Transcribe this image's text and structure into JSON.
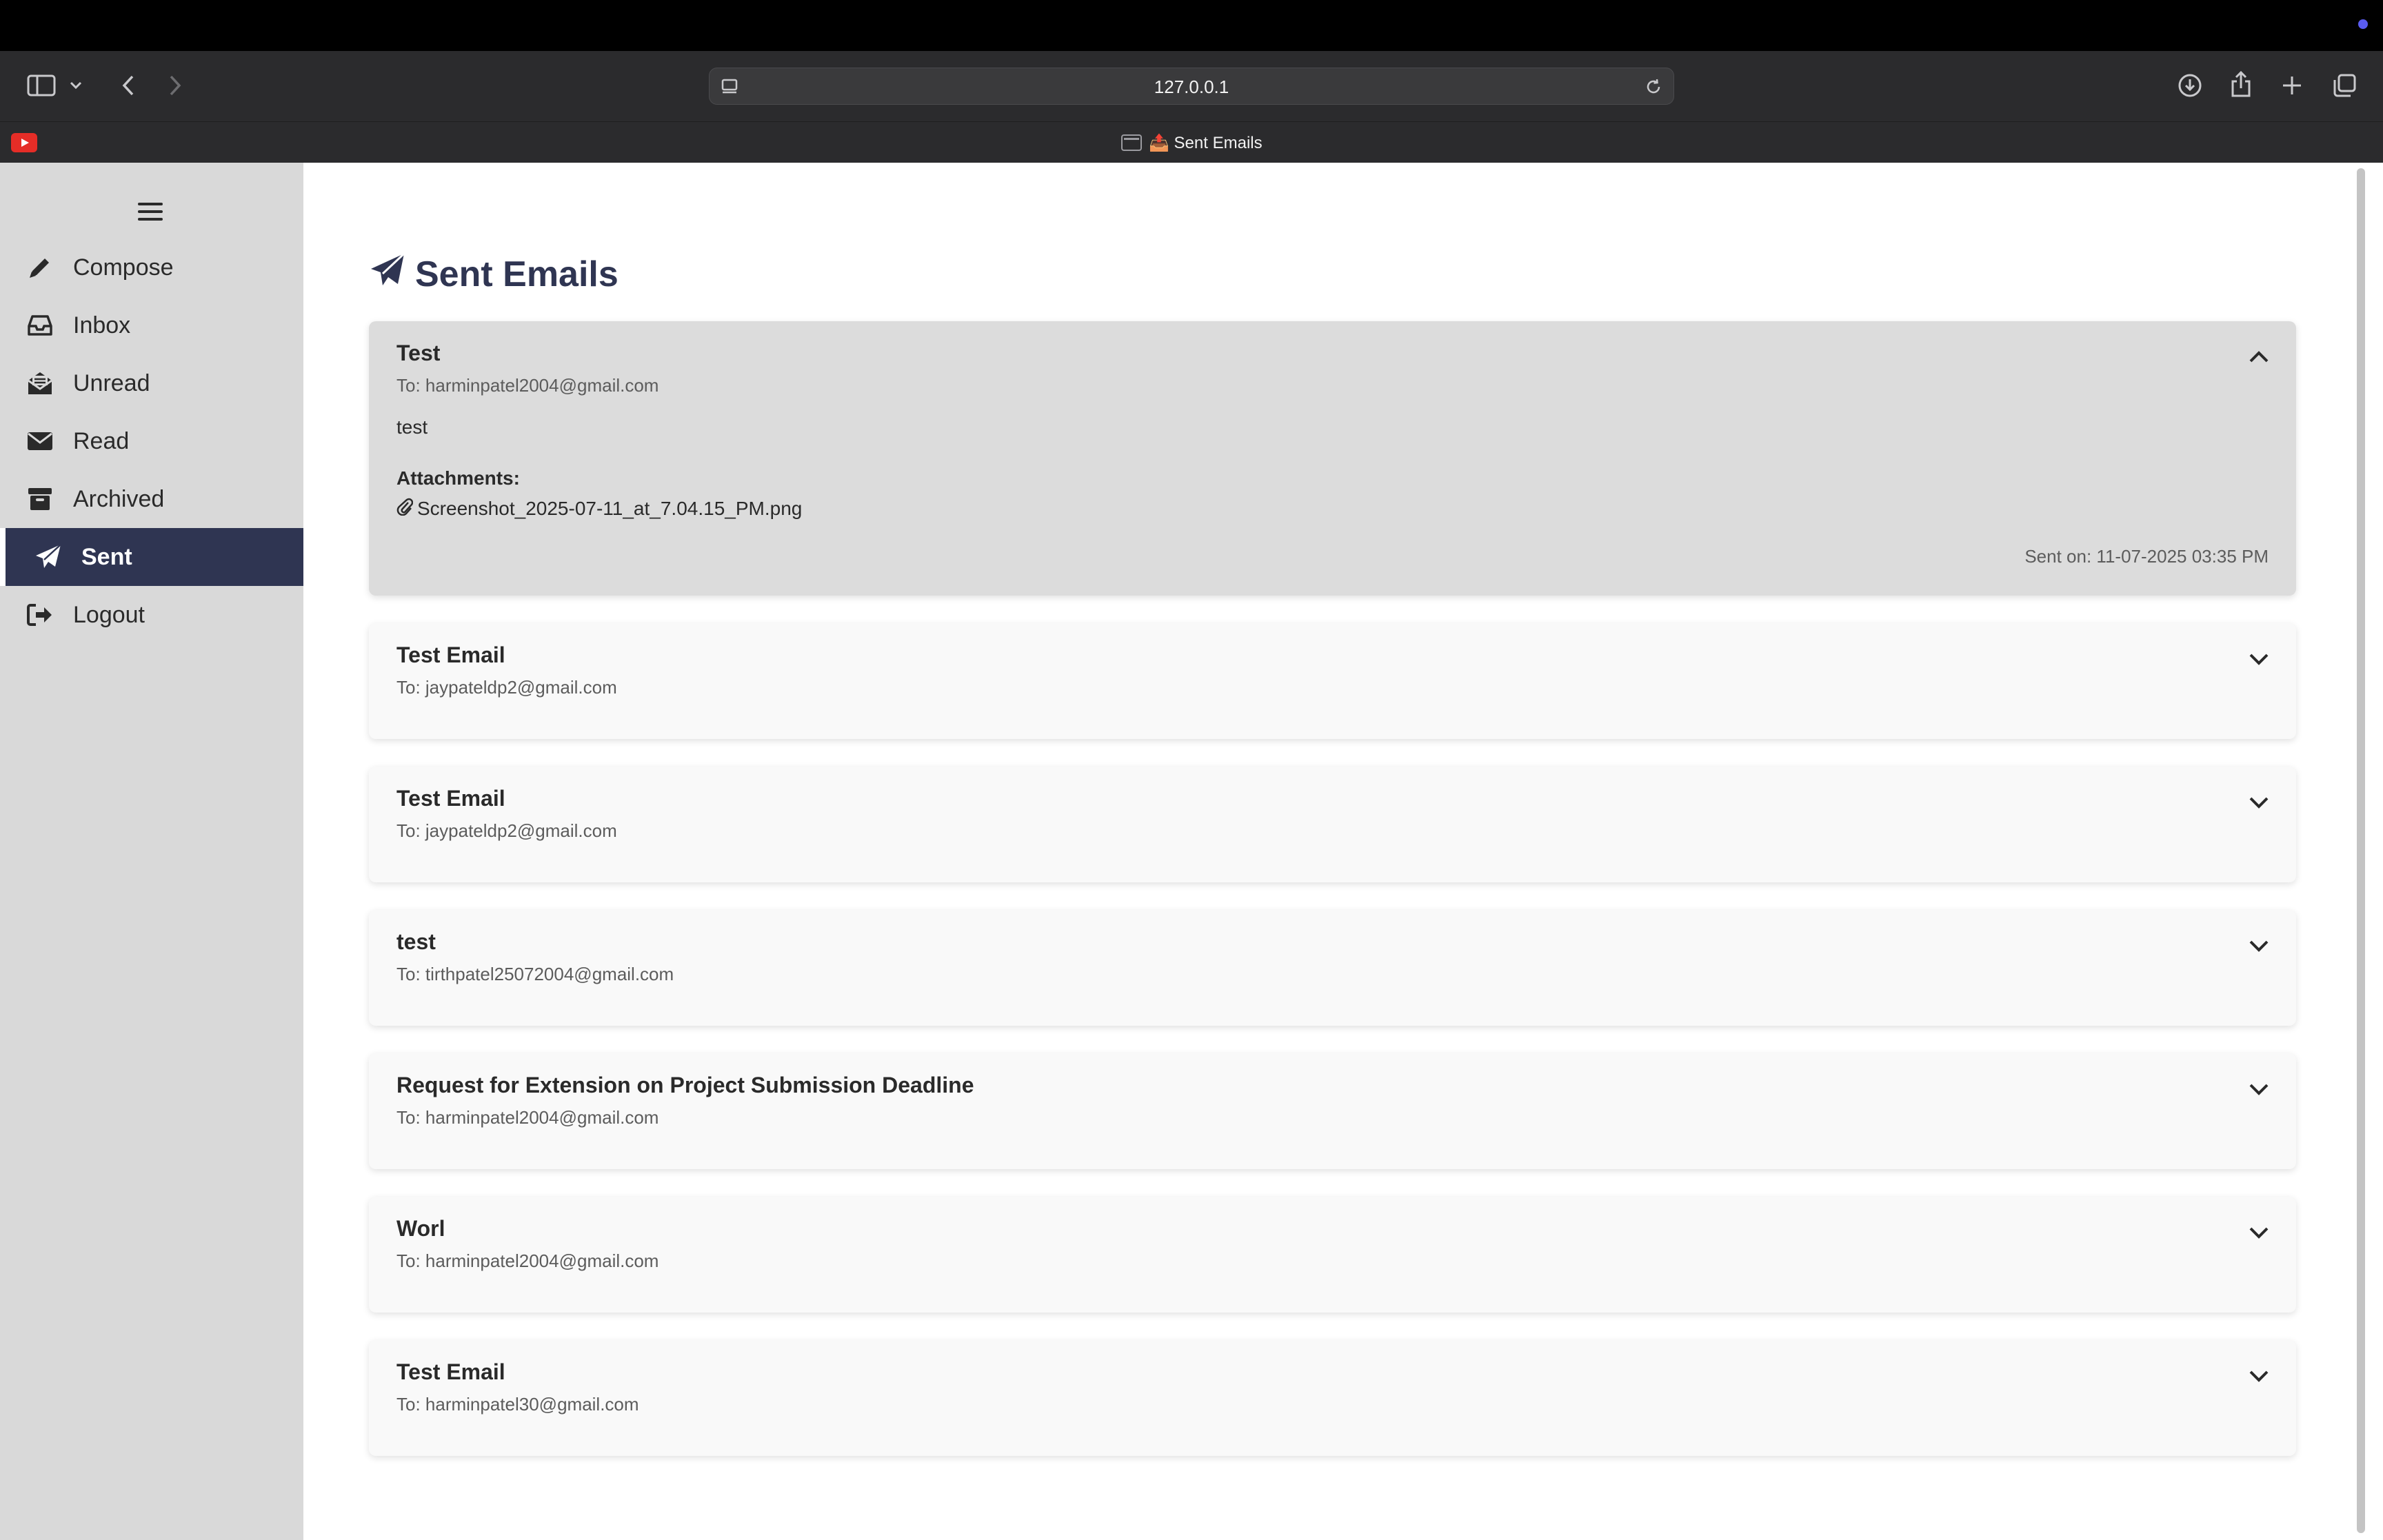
{
  "browser": {
    "url": "127.0.0.1",
    "tab_title": "📤 Sent Emails"
  },
  "sidebar": {
    "items": [
      {
        "label": "Compose",
        "icon": "pencil-icon"
      },
      {
        "label": "Inbox",
        "icon": "inbox-icon"
      },
      {
        "label": "Unread",
        "icon": "envelope-open-icon"
      },
      {
        "label": "Read",
        "icon": "envelope-icon"
      },
      {
        "label": "Archived",
        "icon": "archive-icon"
      },
      {
        "label": "Sent",
        "icon": "paper-plane-icon",
        "active": true
      },
      {
        "label": "Logout",
        "icon": "logout-icon"
      }
    ]
  },
  "main": {
    "title": "Sent Emails",
    "emails": [
      {
        "subject": "Test",
        "to": "To: harminpatel2004@gmail.com",
        "expanded": true,
        "body": "test",
        "attachments_label": "Attachments:",
        "attachment": "Screenshot_2025-07-11_at_7.04.15_PM.png",
        "sent_on": "Sent on: 11-07-2025 03:35 PM"
      },
      {
        "subject": "Test Email",
        "to": "To: jaypateldp2@gmail.com"
      },
      {
        "subject": "Test Email",
        "to": "To: jaypateldp2@gmail.com"
      },
      {
        "subject": "test",
        "to": "To: tirthpatel25072004@gmail.com"
      },
      {
        "subject": "Request for Extension on Project Submission Deadline",
        "to": "To: harminpatel2004@gmail.com"
      },
      {
        "subject": "Worl",
        "to": "To: harminpatel2004@gmail.com"
      },
      {
        "subject": "Test Email",
        "to": "To: harminpatel30@gmail.com"
      }
    ]
  },
  "colors": {
    "sidebar_bg": "#d9d9d9",
    "active_bg": "#2f3552",
    "expanded_card_bg": "#dcdcdc",
    "card_bg": "#f9f9f9"
  }
}
